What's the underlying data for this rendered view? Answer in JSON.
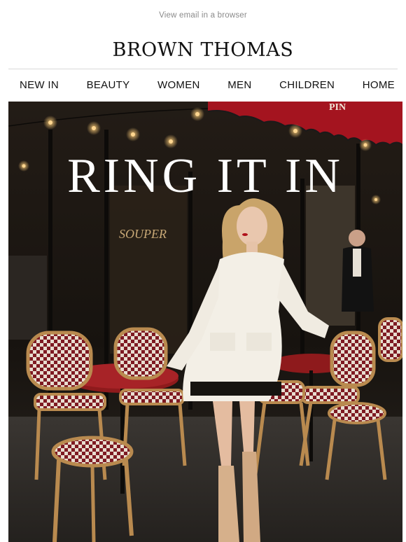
{
  "header": {
    "view_in_browser": "View email in a browser",
    "logo_text": "BROWN THOMAS"
  },
  "nav": {
    "items": [
      {
        "label": "NEW IN"
      },
      {
        "label": "BEAUTY"
      },
      {
        "label": "WOMEN"
      },
      {
        "label": "MEN"
      },
      {
        "label": "CHILDREN"
      },
      {
        "label": "HOME"
      }
    ]
  },
  "hero": {
    "title": "RING IT IN",
    "awning_text": "PIN",
    "window_sign": "SOUPER",
    "colors": {
      "awning": "#a4141f",
      "table_top": "#8e1a1c",
      "dress": "#f3efe6"
    }
  }
}
